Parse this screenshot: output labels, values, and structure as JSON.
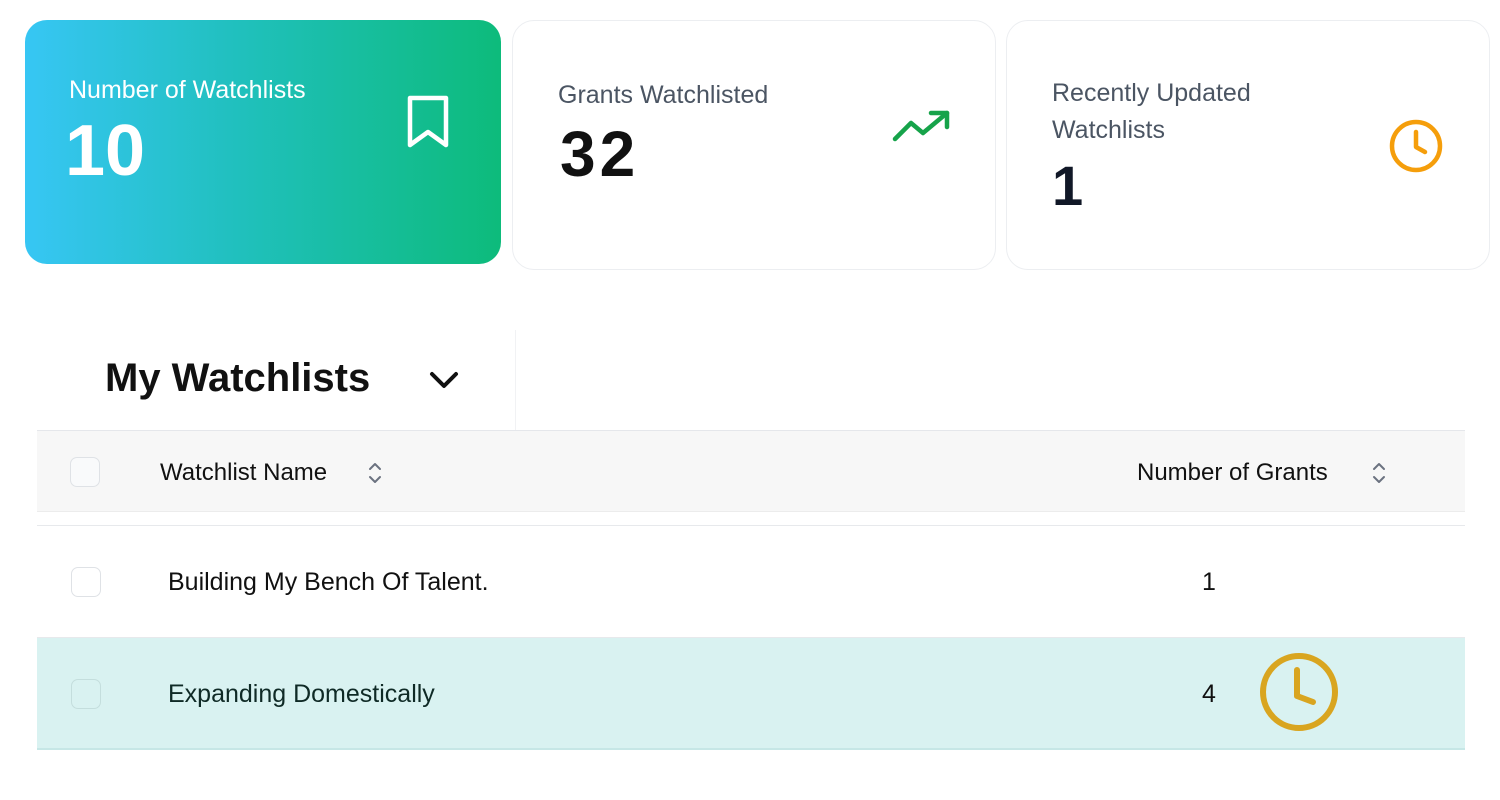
{
  "stats": {
    "watchlists": {
      "label": "Number of Watchlists",
      "value": "10",
      "icon": "bookmark-icon"
    },
    "grants": {
      "label": "Grants Watchlisted",
      "value": "32",
      "icon": "trending-up-icon"
    },
    "recent": {
      "label": "Recently Updated Watchlists",
      "value": "1",
      "icon": "clock-icon"
    }
  },
  "section": {
    "title": "My Watchlists",
    "icon": "chevron-down-icon"
  },
  "table": {
    "columns": {
      "name": "Watchlist Name",
      "count": "Number of Grants"
    },
    "rows": [
      {
        "name": "Building My Bench Of Talent.",
        "count": "1",
        "highlighted": false
      },
      {
        "name": "Expanding Domestically",
        "count": "4",
        "highlighted": true,
        "badge_icon": "clock-icon"
      }
    ]
  },
  "colors": {
    "gradient_start": "#37c6f4",
    "gradient_end": "#0dbb7b",
    "trend_green": "#16a34a",
    "clock_orange": "#f59e0b",
    "row_clock_gold": "#d9a520",
    "highlight_row": "#d9f2f1"
  }
}
